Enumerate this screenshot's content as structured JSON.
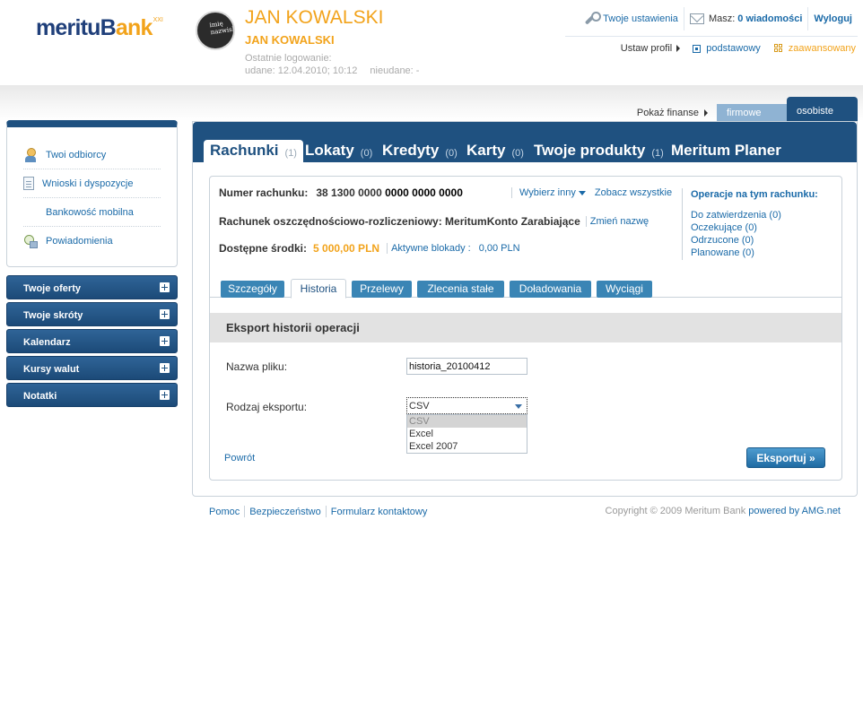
{
  "brand": {
    "logo_text_1": "meritu",
    "logo_text_2": "B",
    "logo_text_3": "ank",
    "logo_sup": "XXI"
  },
  "user": {
    "avatar_text": "imię nazwisko",
    "name": "JAN KOWALSKI",
    "subname": "JAN KOWALSKI",
    "last_login_label": "Ostatnie logowanie:",
    "last_login_ok": "udane: 12.04.2010; 10:12",
    "last_login_fail": "nieudane: -"
  },
  "top_links": {
    "settings": "Twoje ustawienia",
    "inbox_label": "Masz:",
    "inbox_count": "0 wiadomości",
    "logout": "Wyloguj"
  },
  "profile": {
    "label": "Ustaw profil",
    "basic": "podstawowy",
    "advanced": "zaawansowany"
  },
  "finance": {
    "label": "Pokaż finanse",
    "firmowe": "firmowe",
    "osobiste": "osobiste"
  },
  "sidebar": {
    "items": [
      {
        "label": "Twoi odbiorcy",
        "icon": "person-icon"
      },
      {
        "label": "Wnioski i dyspozycje",
        "icon": "document-icon"
      },
      {
        "label": "Bankowość mobilna",
        "icon": "phone-icon"
      },
      {
        "label": "Powiadomienia",
        "icon": "notification-icon"
      }
    ],
    "sections": [
      {
        "label": "Twoje oferty"
      },
      {
        "label": "Twoje skróty"
      },
      {
        "label": "Kalendarz"
      },
      {
        "label": "Kursy walut"
      },
      {
        "label": "Notatki"
      }
    ]
  },
  "main_tabs": [
    {
      "label": "Rachunki",
      "count": "(1)"
    },
    {
      "label": "Lokaty",
      "count": "(0)"
    },
    {
      "label": "Kredyty",
      "count": "(0)"
    },
    {
      "label": "Karty",
      "count": "(0)"
    },
    {
      "label": "Twoje produkty",
      "count": "(1)"
    },
    {
      "label": "Meritum Planer",
      "count": ""
    }
  ],
  "account": {
    "number_label": "Numer rachunku:",
    "number_prefix": "38 1300 0000",
    "number_suffix": "0000 0000 0000",
    "choose_other": "Wybierz inny",
    "see_all": "Zobacz wszystkie",
    "type_label": "Rachunek oszczędnościowo-rozliczeniowy: MeritumKonto Zarabiające",
    "rename": "Zmień nazwę",
    "funds_label": "Dostępne środki:",
    "funds_value": "5 000,00 PLN",
    "blocks_label": "Aktywne blokady :",
    "blocks_value": "0,00 PLN"
  },
  "operations": {
    "title": "Operacje na tym rachunku:",
    "items": [
      "Do zatwierdzenia (0)",
      "Oczekujące (0)",
      "Odrzucone (0)",
      "Planowane (0)"
    ]
  },
  "sub_tabs": [
    "Szczegóły",
    "Historia",
    "Przelewy",
    "Zlecenia stałe",
    "Doładowania",
    "Wyciągi"
  ],
  "export": {
    "title": "Eksport historii operacji",
    "file_label": "Nazwa pliku:",
    "file_value": "historia_20100412",
    "type_label": "Rodzaj eksportu:",
    "type_selected": "CSV",
    "type_options": [
      "CSV",
      "Excel",
      "Excel 2007"
    ],
    "back": "Powrót",
    "button": "Eksportuj »"
  },
  "footer": {
    "help": "Pomoc",
    "security": "Bezpieczeństwo",
    "contact": "Formularz kontaktowy",
    "copyright": "Copyright © 2009 Meritum Bank",
    "powered": "powered by AMG.net"
  },
  "colors": {
    "brand_blue": "#1f5180",
    "accent_orange": "#f2a31b",
    "link_blue": "#1a6aa8"
  }
}
